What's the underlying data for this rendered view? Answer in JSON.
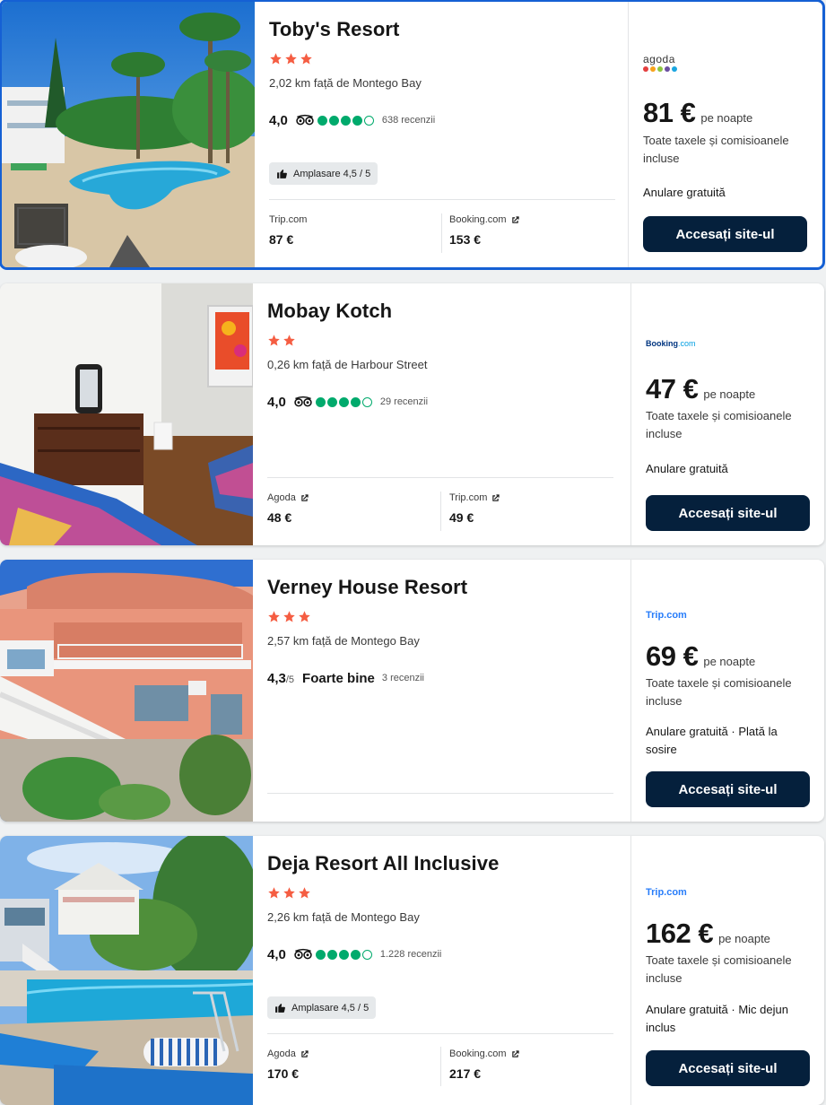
{
  "hotels": [
    {
      "name": "Toby's Resort",
      "stars": 3,
      "distance": "2,02 km față de Montego Bay",
      "rating_score": "4,0",
      "rating_suffix": "",
      "rating_verbal": "",
      "bubbles": 4,
      "reviews": "638 recenzii",
      "badge": "Amplasare 4,5 / 5",
      "providers": [
        {
          "name": "Trip.com",
          "price": "87 €",
          "external": false
        },
        {
          "name": "Booking.com",
          "price": "153 €",
          "external": true
        }
      ],
      "deal": {
        "partner": "agoda",
        "price": "81 €",
        "per_night": "pe noapte",
        "taxes": "Toate taxele și comisioanele incluse",
        "cancellation": "Anulare gratuită",
        "extra": "",
        "button": "Accesați site-ul"
      }
    },
    {
      "name": "Mobay Kotch",
      "stars": 2,
      "distance": "0,26 km față de Harbour Street",
      "rating_score": "4,0",
      "rating_suffix": "",
      "rating_verbal": "",
      "bubbles": 4,
      "reviews": "29 recenzii",
      "badge": "",
      "providers": [
        {
          "name": "Agoda",
          "price": "48 €",
          "external": true
        },
        {
          "name": "Trip.com",
          "price": "49 €",
          "external": true
        }
      ],
      "deal": {
        "partner": "Booking.com",
        "price": "47 €",
        "per_night": "pe noapte",
        "taxes": "Toate taxele și comisioanele incluse",
        "cancellation": "Anulare gratuită",
        "extra": "",
        "button": "Accesați site-ul"
      }
    },
    {
      "name": "Verney House Resort",
      "stars": 3,
      "distance": "2,57 km față de Montego Bay",
      "rating_score": "4,3",
      "rating_suffix": "/5",
      "rating_verbal": "Foarte bine",
      "bubbles": 0,
      "reviews": "3 recenzii",
      "badge": "",
      "providers": [],
      "deal": {
        "partner": "Trip.com",
        "price": "69 €",
        "per_night": "pe noapte",
        "taxes": "Toate taxele și comisioanele incluse",
        "cancellation": "Anulare gratuită · Plată la sosire",
        "extra": "",
        "button": "Accesați site-ul"
      }
    },
    {
      "name": "Deja Resort All Inclusive",
      "stars": 3,
      "distance": "2,26 km față de Montego Bay",
      "rating_score": "4,0",
      "rating_suffix": "",
      "rating_verbal": "",
      "bubbles": 4,
      "reviews": "1.228 recenzii",
      "badge": "Amplasare 4,5 / 5",
      "providers": [
        {
          "name": "Agoda",
          "price": "170 €",
          "external": true
        },
        {
          "name": "Booking.com",
          "price": "217 €",
          "external": true
        }
      ],
      "deal": {
        "partner": "Trip.com",
        "price": "162 €",
        "per_night": "pe noapte",
        "taxes": "Toate taxele și comisioanele incluse",
        "cancellation": "Anulare gratuită · Mic dejun inclus",
        "extra": "",
        "button": "Accesați site-ul"
      }
    }
  ],
  "logos": {
    "agoda_word": "agoda",
    "booking_word": "Booking",
    "booking_suffix": ".com",
    "trip_word": "Trip.com"
  },
  "colors": {
    "star": "#f55d42",
    "bubble": "#00aa6c",
    "button": "#05203c",
    "selected_border": "#1560d4"
  },
  "icons": [
    "star-icon",
    "tripadvisor-icon",
    "rating-bubble",
    "thumbs-up-icon",
    "external-link-icon"
  ]
}
